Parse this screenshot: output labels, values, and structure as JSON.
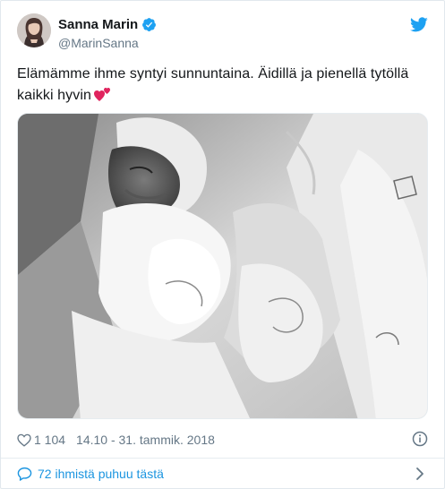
{
  "user": {
    "display_name": "Sanna Marin",
    "handle": "@MarinSanna",
    "verified": true,
    "avatar_icon": "avatar-photo"
  },
  "brand": {
    "icon": "twitter-bird-icon",
    "color": "#1da1f2"
  },
  "tweet": {
    "text": "Elämämme ihme syntyi sunnuntaina. Äidillä ja pienellä tytöllä kaikki hyvin",
    "emoji": "two-hearts-emoji",
    "media": "black-and-white photo of a newborn baby wrapped in blankets"
  },
  "meta": {
    "like_count": "1 104",
    "timestamp": "14.10 - 31. tammik. 2018",
    "info_icon": "info-icon"
  },
  "conversation": {
    "label": "72 ihmistä puhuu tästä",
    "icon": "speech-bubble-icon",
    "chevron": "chevron-right-icon"
  },
  "colors": {
    "text": "#14171a",
    "secondary": "#657786",
    "link": "#1b95e0",
    "verified": "#1da1f2",
    "heart": "#e0245e"
  }
}
